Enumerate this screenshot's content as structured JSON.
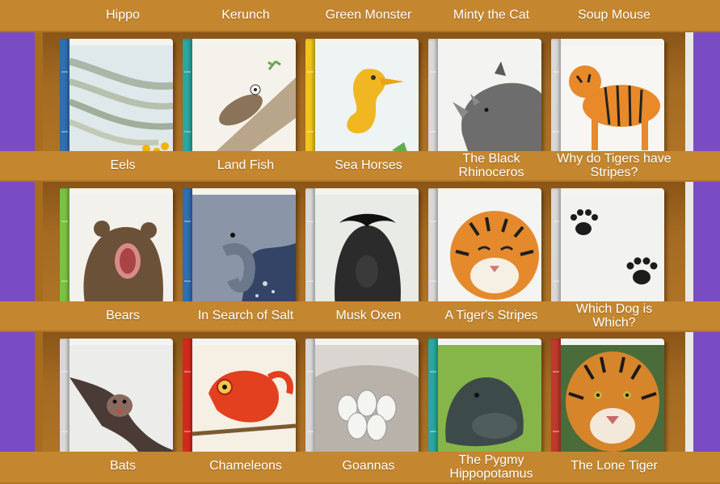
{
  "top_labels": [
    "Hippo",
    "Kerunch",
    "Green Monster",
    "Minty the Cat",
    "Soup Mouse"
  ],
  "rows": [
    {
      "books": [
        {
          "title": "Eels",
          "spine_color": "#2f6fb3",
          "icon": "eels-illustration"
        },
        {
          "title": "Land Fish",
          "spine_color": "#2aa7a0",
          "icon": "mudskipper-illustration"
        },
        {
          "title": "Sea Horses",
          "spine_color": "#f0c419",
          "icon": "seahorse-illustration"
        },
        {
          "title": "The Black Rhinoceros",
          "spine_color": "#d8d8d8",
          "icon": "rhinoceros-illustration"
        },
        {
          "title": "Why do Tigers have Stripes?",
          "spine_color": "#d8d8d8",
          "icon": "tiger-illustration"
        }
      ]
    },
    {
      "books": [
        {
          "title": "Bears",
          "spine_color": "#7cc242",
          "icon": "bear-illustration"
        },
        {
          "title": "In Search of Salt",
          "spine_color": "#2f6fb3",
          "icon": "elephant-illustration"
        },
        {
          "title": "Musk Oxen",
          "spine_color": "#d8d8d8",
          "icon": "musk-ox-illustration"
        },
        {
          "title": "A Tiger's Stripes",
          "spine_color": "#d8d8d8",
          "icon": "tiger-face-illustration"
        },
        {
          "title": "Which Dog is Which?",
          "spine_color": "#d8d8d8",
          "icon": "paw-prints-illustration"
        }
      ]
    },
    {
      "books": [
        {
          "title": "Bats",
          "spine_color": "#d8d8d8",
          "icon": "bat-illustration"
        },
        {
          "title": "Chameleons",
          "spine_color": "#d42a1e",
          "icon": "chameleon-illustration"
        },
        {
          "title": "Goannas",
          "spine_color": "#d8d8d8",
          "icon": "goanna-eggs-illustration"
        },
        {
          "title": "The Pygmy Hippopotamus",
          "spine_color": "#2aa7a0",
          "icon": "pygmy-hippo-illustration"
        },
        {
          "title": "The Lone Tiger",
          "spine_color": "#c0392b",
          "icon": "lone-tiger-illustration"
        }
      ]
    }
  ]
}
